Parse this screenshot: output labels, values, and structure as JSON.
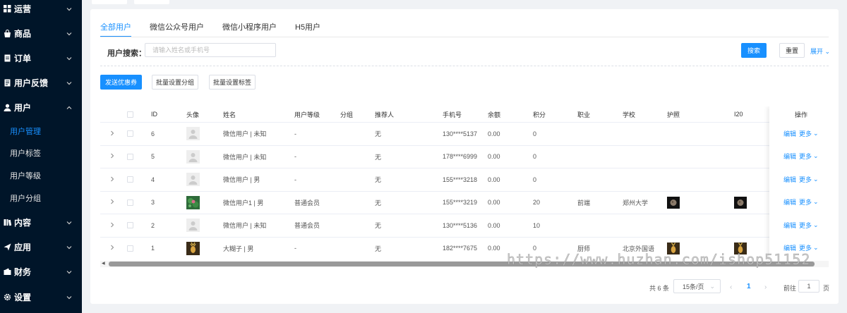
{
  "sidebar": {
    "items": [
      {
        "label": "运营",
        "icon": "grid-icon",
        "expanded": false
      },
      {
        "label": "商品",
        "icon": "bag-icon",
        "expanded": false
      },
      {
        "label": "订单",
        "icon": "document-icon",
        "expanded": false
      },
      {
        "label": "用户反馈",
        "icon": "feedback-icon",
        "expanded": false
      },
      {
        "label": "用户",
        "icon": "user-icon",
        "expanded": true
      },
      {
        "label": "内容",
        "icon": "book-icon",
        "expanded": false
      },
      {
        "label": "应用",
        "icon": "send-icon",
        "expanded": false
      },
      {
        "label": "财务",
        "icon": "wallet-icon",
        "expanded": false
      },
      {
        "label": "设置",
        "icon": "gear-icon",
        "expanded": false
      }
    ],
    "sub_items": [
      {
        "label": "用户管理",
        "active": true
      },
      {
        "label": "用户标签",
        "active": false
      },
      {
        "label": "用户等级",
        "active": false
      },
      {
        "label": "用户分组",
        "active": false
      }
    ]
  },
  "tabs": [
    {
      "label": "全部用户",
      "active": true
    },
    {
      "label": "微信公众号用户",
      "active": false
    },
    {
      "label": "微信小程序用户",
      "active": false
    },
    {
      "label": "H5用户",
      "active": false
    }
  ],
  "search": {
    "label": "用户搜索：",
    "placeholder": "请输入姓名或手机号",
    "search_button": "搜索",
    "reset_button": "重置",
    "expand_link": "展开"
  },
  "actions": {
    "send_coupon": "发送优惠券",
    "batch_group": "批量设置分组",
    "batch_tag": "批量设置标签"
  },
  "table": {
    "columns": [
      "ID",
      "头像",
      "姓名",
      "用户等级",
      "分组",
      "推荐人",
      "手机号",
      "余额",
      "积分",
      "职业",
      "学校",
      "护照",
      "I20",
      "操作"
    ],
    "rows": [
      {
        "id": "6",
        "avatar": "default",
        "name": "微信用户 | 未知",
        "level": "-",
        "group": "",
        "referrer": "无",
        "phone": "130****5137",
        "balance": "0.00",
        "points": "0",
        "job": "",
        "school": "",
        "passport": "",
        "i20": "",
        "edit": "编辑",
        "more": "更多"
      },
      {
        "id": "5",
        "avatar": "default",
        "name": "微信用户 | 未知",
        "level": "-",
        "group": "",
        "referrer": "无",
        "phone": "178****6999",
        "balance": "0.00",
        "points": "0",
        "job": "",
        "school": "",
        "passport": "",
        "i20": "",
        "edit": "编辑",
        "more": "更多"
      },
      {
        "id": "4",
        "avatar": "default",
        "name": "微信用户 | 男",
        "level": "-",
        "group": "",
        "referrer": "无",
        "phone": "155****3218",
        "balance": "0.00",
        "points": "0",
        "job": "",
        "school": "",
        "passport": "",
        "i20": "",
        "edit": "编辑",
        "more": "更多"
      },
      {
        "id": "3",
        "avatar": "lotus",
        "name": "微信用户1 | 男",
        "level": "普通会员",
        "group": "",
        "referrer": "无",
        "phone": "155****3219",
        "balance": "0.00",
        "points": "20",
        "job": "前端",
        "school": "郑州大学",
        "passport": "moon",
        "i20": "moon",
        "edit": "编辑",
        "more": "更多"
      },
      {
        "id": "2",
        "avatar": "default",
        "name": "微信用户 | 未知",
        "level": "普通会员",
        "group": "",
        "referrer": "无",
        "phone": "130****5136",
        "balance": "0.00",
        "points": "10",
        "job": "",
        "school": "",
        "passport": "",
        "i20": "",
        "edit": "编辑",
        "more": "更多"
      },
      {
        "id": "1",
        "avatar": "deer",
        "name": "大糊子 | 男",
        "level": "-",
        "group": "",
        "referrer": "无",
        "phone": "182****7675",
        "balance": "0.00",
        "points": "0",
        "job": "厨师",
        "school": "北京外国语",
        "passport": "deer",
        "i20": "deer",
        "edit": "编辑",
        "more": "更多"
      }
    ]
  },
  "pagination": {
    "total": "共 6 条",
    "page_size": "15条/页",
    "current": "1",
    "goto_label": "前往",
    "goto_value": "1",
    "unit": "页"
  },
  "watermark": "https://www.huzhan.com/ishop51152",
  "colors": {
    "sidebar_bg": "#001529",
    "primary": "#1890ff"
  }
}
